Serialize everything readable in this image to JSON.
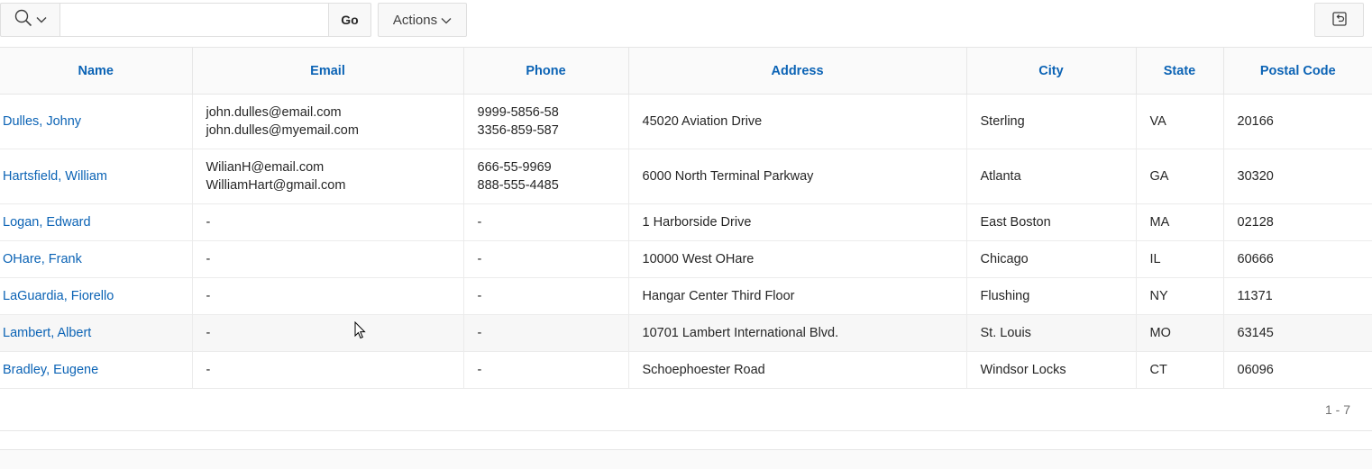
{
  "toolbar": {
    "search_column_icon": "search-icon",
    "search_value": "",
    "go_label": "Go",
    "actions_label": "Actions",
    "reset_icon": "reset-icon"
  },
  "table": {
    "columns": [
      "Name",
      "Email",
      "Phone",
      "Address",
      "City",
      "State",
      "Postal Code"
    ],
    "rows": [
      {
        "name": "Dulles, Johny",
        "email": [
          "john.dulles@email.com",
          "john.dulles@myemail.com"
        ],
        "phone": [
          "9999-5856-58",
          "3356-859-587"
        ],
        "address": "45020 Aviation Drive",
        "city": "Sterling",
        "state": "VA",
        "postal": "20166"
      },
      {
        "name": "Hartsfield, William",
        "email": [
          "WilianH@email.com",
          "WilliamHart@gmail.com"
        ],
        "phone": [
          "666-55-9969",
          "888-555-4485"
        ],
        "address": "6000 North Terminal Parkway",
        "city": "Atlanta",
        "state": "GA",
        "postal": "30320"
      },
      {
        "name": "Logan, Edward",
        "email": [
          "-"
        ],
        "phone": [
          "-"
        ],
        "address": "1 Harborside Drive",
        "city": "East Boston",
        "state": "MA",
        "postal": "02128"
      },
      {
        "name": "OHare, Frank",
        "email": [
          "-"
        ],
        "phone": [
          "-"
        ],
        "address": "10000 West OHare",
        "city": "Chicago",
        "state": "IL",
        "postal": "60666"
      },
      {
        "name": "LaGuardia, Fiorello",
        "email": [
          "-"
        ],
        "phone": [
          "-"
        ],
        "address": "Hangar Center Third Floor",
        "city": "Flushing",
        "state": "NY",
        "postal": "11371"
      },
      {
        "name": "Lambert, Albert",
        "email": [
          "-"
        ],
        "phone": [
          "-"
        ],
        "address": "10701 Lambert International Blvd.",
        "city": "St. Louis",
        "state": "MO",
        "postal": "63145"
      },
      {
        "name": "Bradley, Eugene",
        "email": [
          "-"
        ],
        "phone": [
          "-"
        ],
        "address": "Schoephoester Road",
        "city": "Windsor Locks",
        "state": "CT",
        "postal": "06096"
      }
    ]
  },
  "pagination": {
    "label": "1 - 7"
  },
  "colors": {
    "link": "#0b63b5",
    "border": "#e6e6e6",
    "header_bg": "#fafafa",
    "button_bg": "#f8f8f8"
  }
}
